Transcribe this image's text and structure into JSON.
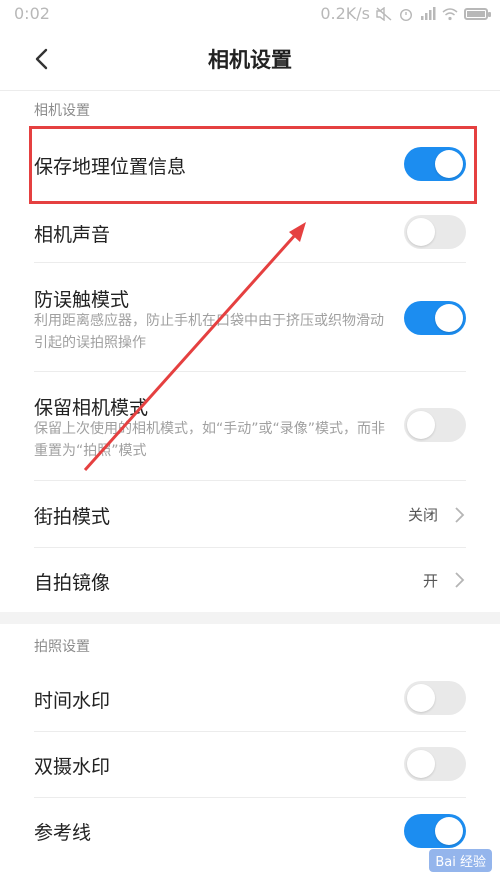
{
  "status_bar": {
    "time": "0:02",
    "network_speed": "0.2K/s"
  },
  "header": {
    "title": "相机设置"
  },
  "section1": {
    "label": "相机设置"
  },
  "rows": {
    "save_location": {
      "label": "保存地理位置信息",
      "on": true
    },
    "camera_sound": {
      "label": "相机声音",
      "on": false
    },
    "anti_touch": {
      "label": "防误触模式",
      "desc": "利用距离感应器，防止手机在口袋中由于挤压或织物滑动引起的误拍照操作",
      "on": true
    },
    "keep_mode": {
      "label": "保留相机模式",
      "desc": "保留上次使用的相机模式，如“手动”或“录像”模式，而非重置为“拍照”模式",
      "on": false
    },
    "street_mode": {
      "label": "街拍模式",
      "value": "关闭"
    },
    "selfie_mirror": {
      "label": "自拍镜像",
      "value": "开"
    }
  },
  "section2": {
    "label": "拍照设置"
  },
  "rows2": {
    "time_watermark": {
      "label": "时间水印",
      "on": false
    },
    "dual_watermark": {
      "label": "双摄水印",
      "on": false
    },
    "grid_lines": {
      "label": "参考线",
      "on": true
    }
  },
  "watermark": {
    "text": "Bai 经验"
  },
  "colors": {
    "accent": "#1c8df0",
    "highlight": "#e54040"
  }
}
